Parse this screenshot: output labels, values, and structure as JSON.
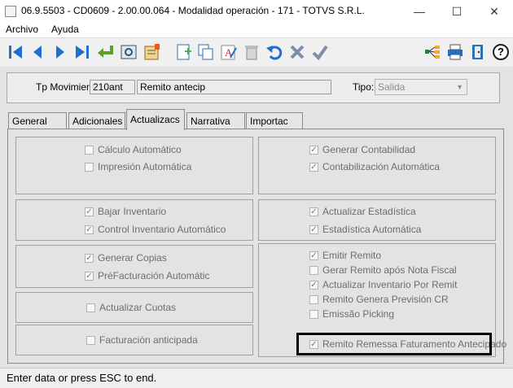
{
  "window": {
    "title": "06.9.5503 - CD0609 - 2.00.00.064 - Modalidad operación - 171 - TOTVS S.R.L.",
    "minimize_glyph": "—",
    "maximize_glyph": "☐",
    "close_glyph": "✕"
  },
  "menu": [
    "Archivo",
    "Ayuda"
  ],
  "toolbar": {
    "buttons": [
      "first-record-icon",
      "previous-record-icon",
      "next-record-icon",
      "last-record-icon",
      "return-icon",
      "view-icon",
      "edit-form-icon",
      "new-record-icon",
      "copy-icon",
      "text-edit-icon",
      "delete-icon",
      "undo-icon",
      "cancel-icon",
      "confirm-icon",
      "hierarchy-icon",
      "print-icon",
      "exit-icon"
    ],
    "help_label": "?"
  },
  "header": {
    "tp_label": "Tp Movimien:",
    "tp_code": "210ant",
    "tp_desc": "Remito antecip",
    "tipo_label": "Tipo:",
    "tipo_value": "Salida"
  },
  "tabs": [
    "General",
    "Adicionales",
    "Actualizacs",
    "Narrativa",
    "Importac"
  ],
  "left_groups": [
    [
      {
        "label": "Cálculo Automático",
        "checked": false
      },
      {
        "label": "Impresión Automática",
        "checked": false
      }
    ],
    [
      {
        "label": "Bajar Inventario",
        "checked": true
      },
      {
        "label": "Control Inventario Automático",
        "checked": true
      }
    ],
    [
      {
        "label": "Generar Copias",
        "checked": true
      },
      {
        "label": "PréFacturación Automátic",
        "checked": true
      }
    ],
    [
      {
        "label": "Actualizar Cuotas",
        "checked": false
      }
    ],
    [
      {
        "label": "Facturación anticipada",
        "checked": false
      }
    ]
  ],
  "right_groups": [
    [
      {
        "label": "Generar Contabilidad",
        "checked": true
      },
      {
        "label": "Contabilización Automática",
        "checked": true
      }
    ],
    [
      {
        "label": "Actualizar Estadística",
        "checked": true
      },
      {
        "label": "Estadística Automática",
        "checked": true
      }
    ],
    [
      {
        "label": "Emitir Remito",
        "checked": true
      },
      {
        "label": "Gerar Remito após Nota Fiscal",
        "checked": false
      },
      {
        "label": "Actualizar Inventario Por Remit",
        "checked": true
      },
      {
        "label": "Remito Genera Previsión CR",
        "checked": false
      },
      {
        "label": "Emissão Picking",
        "checked": false
      },
      {
        "label": "Remito Remessa Faturamento Antecipado",
        "checked": true
      }
    ]
  ],
  "check_glyph": "✓",
  "status": "Enter data or press ESC to end."
}
